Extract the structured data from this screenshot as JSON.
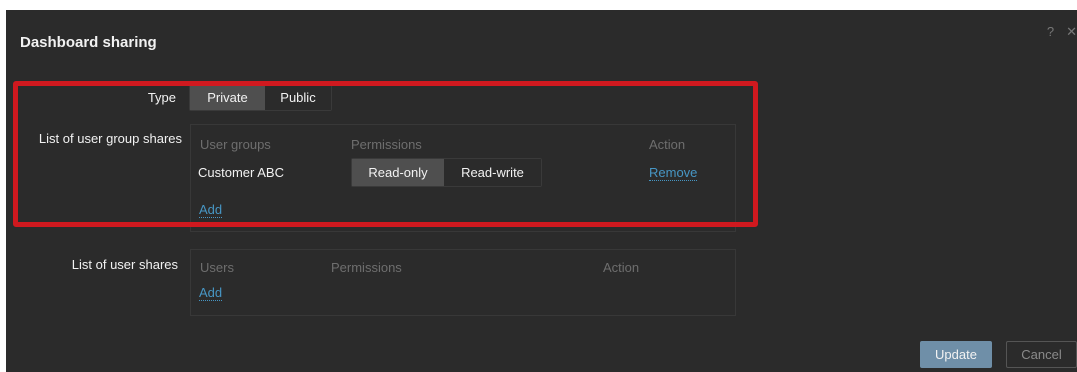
{
  "dialog": {
    "title": "Dashboard sharing",
    "help_icon": "?",
    "close_icon": "✕"
  },
  "type_row": {
    "label": "Type",
    "options": [
      "Private",
      "Public"
    ],
    "selected": "Private"
  },
  "group_shares": {
    "label": "List of user group shares",
    "columns": [
      "User groups",
      "Permissions",
      "Action"
    ],
    "rows": [
      {
        "name": "Customer ABC",
        "permissions": [
          "Read-only",
          "Read-write"
        ],
        "selected": "Read-only",
        "action": "Remove"
      }
    ],
    "add_label": "Add"
  },
  "user_shares": {
    "label": "List of user shares",
    "columns": [
      "Users",
      "Permissions",
      "Action"
    ],
    "add_label": "Add"
  },
  "footer": {
    "update_label": "Update",
    "cancel_label": "Cancel"
  },
  "colors": {
    "background": "#2b2b2b",
    "link": "#4796c4",
    "highlight": "#d0191f",
    "primary_button": "#6f8fa8"
  }
}
